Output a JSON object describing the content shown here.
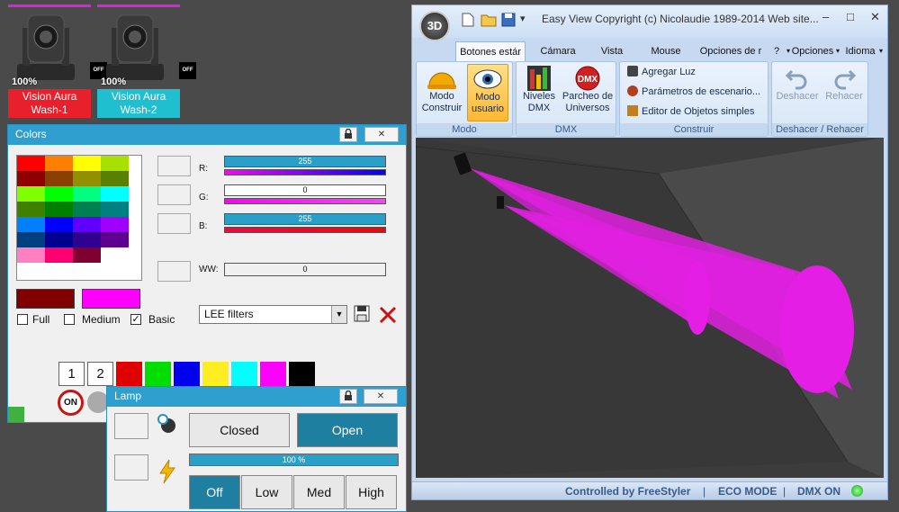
{
  "fixtures": [
    {
      "percent": "100%",
      "off": "OFF",
      "name": "Vision Aura Wash-1",
      "name_color": "#e8202c"
    },
    {
      "percent": "100%",
      "off": "OFF",
      "name": "Vision Aura Wash-2",
      "name_color": "#1fbfd0"
    }
  ],
  "colors_panel": {
    "title": "Colors",
    "lock_icon": "lock-icon",
    "close_label": "✕",
    "channels": [
      {
        "label": "R:",
        "value": "255"
      },
      {
        "label": "G:",
        "value": "0"
      },
      {
        "label": "B:",
        "value": "255"
      },
      {
        "label": "WW:",
        "value": "0"
      }
    ],
    "checkboxes": [
      {
        "label": "Full",
        "checked": false
      },
      {
        "label": "Medium",
        "checked": false
      },
      {
        "label": "Basic",
        "checked": true
      }
    ],
    "filter_select": "LEE filters",
    "preset_buttons": [
      "1",
      "2"
    ],
    "on_label": "ON",
    "swatches": [
      "#e00000",
      "#00dd00",
      "#0000ee",
      "#ffee22",
      "#00ffff",
      "#ff00ff",
      "#000000"
    ],
    "current_colors": [
      "#800000",
      "#ff00ff"
    ]
  },
  "lamp_panel": {
    "title": "Lamp",
    "close_label": "✕",
    "closed": "Closed",
    "open": "Open",
    "progress_text": "100 %",
    "progress": 1.0,
    "levels": [
      "Off",
      "Low",
      "Med",
      "High"
    ]
  },
  "app": {
    "logo": "3D",
    "title_bar": "Easy View   Copyright (c) Nicolaudie 1989-2014   Web site...",
    "title_controls": [
      "–",
      "□",
      "✕"
    ],
    "tabs": [
      "Botones estár",
      "Cámara",
      "Vista",
      "Mouse",
      "Opciones de r"
    ],
    "right_menus": [
      "?",
      "Opciones",
      "Idioma"
    ],
    "groups": {
      "modo": {
        "title": "Modo",
        "buttons": [
          "Modo Construir",
          "Modo usuario"
        ]
      },
      "dmx": {
        "title": "DMX",
        "buttons": [
          "Niveles DMX",
          "Parcheo de Universos"
        ]
      },
      "construir": {
        "title": "Construir",
        "items": [
          "Agregar Luz",
          "Parámetros de escenario...",
          "Editor de Objetos simples"
        ]
      },
      "undo": {
        "title": "Deshacer / Rehacer",
        "buttons": [
          "Deshacer",
          "Rehacer"
        ]
      }
    },
    "status": [
      "Controlled by FreeStyler",
      "ECO MODE",
      "DMX ON"
    ],
    "dmx_logo": "DMX"
  }
}
